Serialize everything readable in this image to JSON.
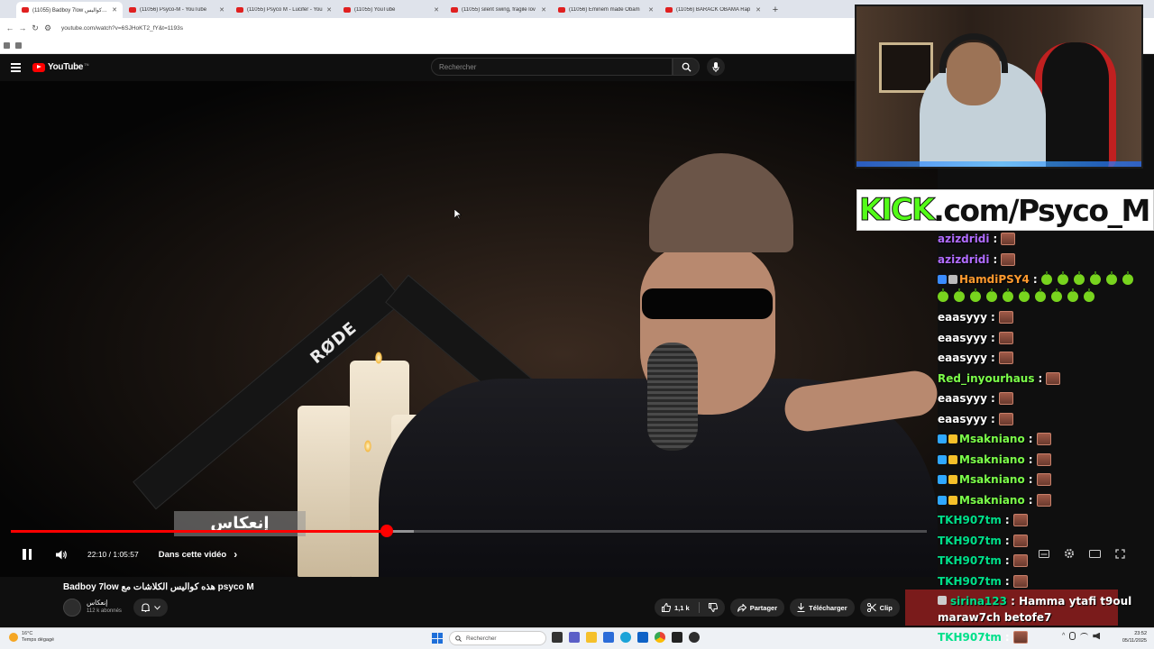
{
  "browser": {
    "tabs": [
      {
        "title": "(11055) Badboy 7low هذه كواليس",
        "active": true
      },
      {
        "title": "(11056) Psyco-M - YouTube",
        "active": false
      },
      {
        "title": "(11055) Psyco M - Lucifer - You",
        "active": false
      },
      {
        "title": "(11055) YouTube",
        "active": false
      },
      {
        "title": "(11055) silent swing, fragile lov",
        "active": false
      },
      {
        "title": "(11056) Eminem made Obam",
        "active": false
      },
      {
        "title": "(11056) BARACK OBAMA Rap",
        "active": false
      }
    ],
    "new_tab": "+",
    "url": "youtube.com/watch?v=6SJHoKT2_fY&t=1193s"
  },
  "youtube": {
    "logo_text": "YouTube",
    "logo_sup": "TN",
    "search_placeholder": "Rechercher"
  },
  "player": {
    "subtitle_overlay": "إنعكاس",
    "current_time": "22:10",
    "duration": "1:05:57",
    "time_display": "22:10 / 1:05:57",
    "progress_fraction": 0.41,
    "buffered_fraction": 0.44,
    "chapter_label": "Dans cette vidéo",
    "chapter_arrow": "›"
  },
  "video_info": {
    "title": "Badboy 7low هذه كواليس الكلاشات مع psyco M",
    "channel_name": "إنعكاس",
    "subscribers": "112 k abonnés",
    "likes": "1,1 k",
    "share_label": "Partager",
    "download_label": "Télécharger",
    "clip_label": "Clip",
    "more_label": "···"
  },
  "overlay": {
    "kick_logo": "KICK",
    "kick_url": ".com/Psyco_M"
  },
  "chat": {
    "messages": [
      {
        "user": "azizdridi",
        "color": "#b06cff",
        "content": "emote"
      },
      {
        "user": "azizdridi",
        "color": "#b06cff",
        "content": "emote"
      },
      {
        "user": "HamdiPSY4",
        "color": "#ff9a2e",
        "content": "apples"
      },
      {
        "user": "eaasyyy",
        "color": "#ffffff",
        "content": "emote"
      },
      {
        "user": "eaasyyy",
        "color": "#ffffff",
        "content": "emote"
      },
      {
        "user": "eaasyyy",
        "color": "#ffffff",
        "content": "emote"
      },
      {
        "user": "Red_inyourhaus",
        "color": "#7cff4a",
        "content": "emote"
      },
      {
        "user": "eaasyyy",
        "color": "#ffffff",
        "content": "emote"
      },
      {
        "user": "eaasyyy",
        "color": "#ffffff",
        "content": "emote"
      },
      {
        "user": "Msakniano",
        "color": "#7cff4a",
        "content": "emote"
      },
      {
        "user": "Msakniano",
        "color": "#7cff4a",
        "content": "emote"
      },
      {
        "user": "Msakniano",
        "color": "#7cff4a",
        "content": "emote"
      },
      {
        "user": "Msakniano",
        "color": "#7cff4a",
        "content": "emote"
      },
      {
        "user": "TKH907tm",
        "color": "#00e08a",
        "content": "emote"
      },
      {
        "user": "TKH907tm",
        "color": "#00e08a",
        "content": "emote"
      },
      {
        "user": "TKH907tm",
        "color": "#00e08a",
        "content": "emote"
      },
      {
        "user": "TKH907tm",
        "color": "#00e08a",
        "content": "emote"
      }
    ],
    "highlight": {
      "user": "sirina123",
      "line1": "Hamma ytafi t9oul",
      "line2": "maraw7ch betofe7"
    },
    "bottom_user": "TKH907tm"
  },
  "taskbar": {
    "weather_temp": "16°C",
    "weather_desc": "Temps dégagé",
    "search_placeholder": "Rechercher",
    "time": "23:52",
    "date": "05/11/2025"
  },
  "colors": {
    "yt_red": "#ff0000",
    "kick_green": "#53fc18",
    "chat_highlight_bg": "#7a1b1b"
  }
}
